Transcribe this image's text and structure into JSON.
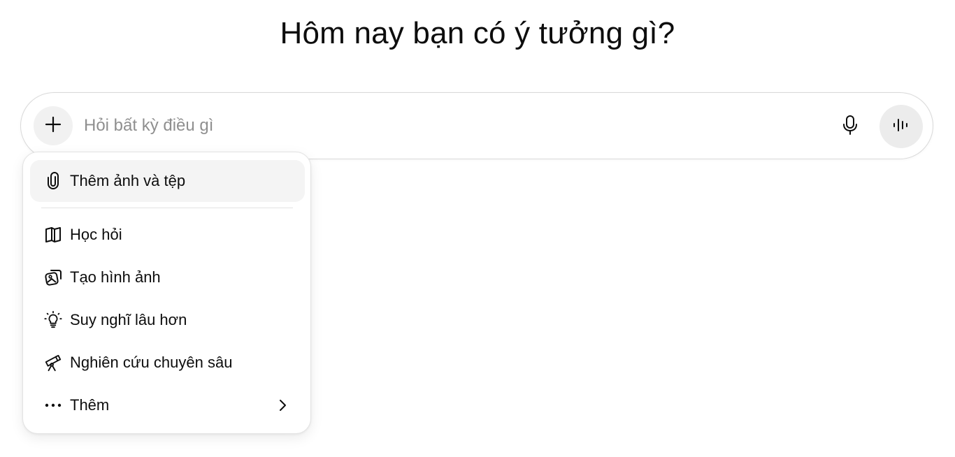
{
  "heading": "Hôm nay bạn có ý tưởng gì?",
  "composer": {
    "placeholder": "Hỏi bất kỳ điều gì",
    "value": "",
    "plus_icon": "plus-icon",
    "mic_icon": "microphone-icon",
    "voice_icon": "voice-waveform-icon"
  },
  "menu": {
    "items": [
      {
        "label": "Thêm ảnh và tệp",
        "icon": "paperclip-icon",
        "highlighted": true
      },
      {
        "label": "Học hỏi",
        "icon": "open-book-icon"
      },
      {
        "label": "Tạo hình ảnh",
        "icon": "image-stack-icon"
      },
      {
        "label": "Suy nghĩ lâu hơn",
        "icon": "lightbulb-icon"
      },
      {
        "label": "Nghiên cứu chuyên sâu",
        "icon": "telescope-icon"
      },
      {
        "label": "Thêm",
        "icon": "more-dots-icon",
        "submenu_icon": "chevron-right-icon"
      }
    ]
  },
  "colors": {
    "text": "#0d0d0d",
    "placeholder": "#8f8f8f",
    "border": "#d9d9d9",
    "button_bg": "#f1f1f1",
    "highlight_bg": "#f4f4f4"
  }
}
